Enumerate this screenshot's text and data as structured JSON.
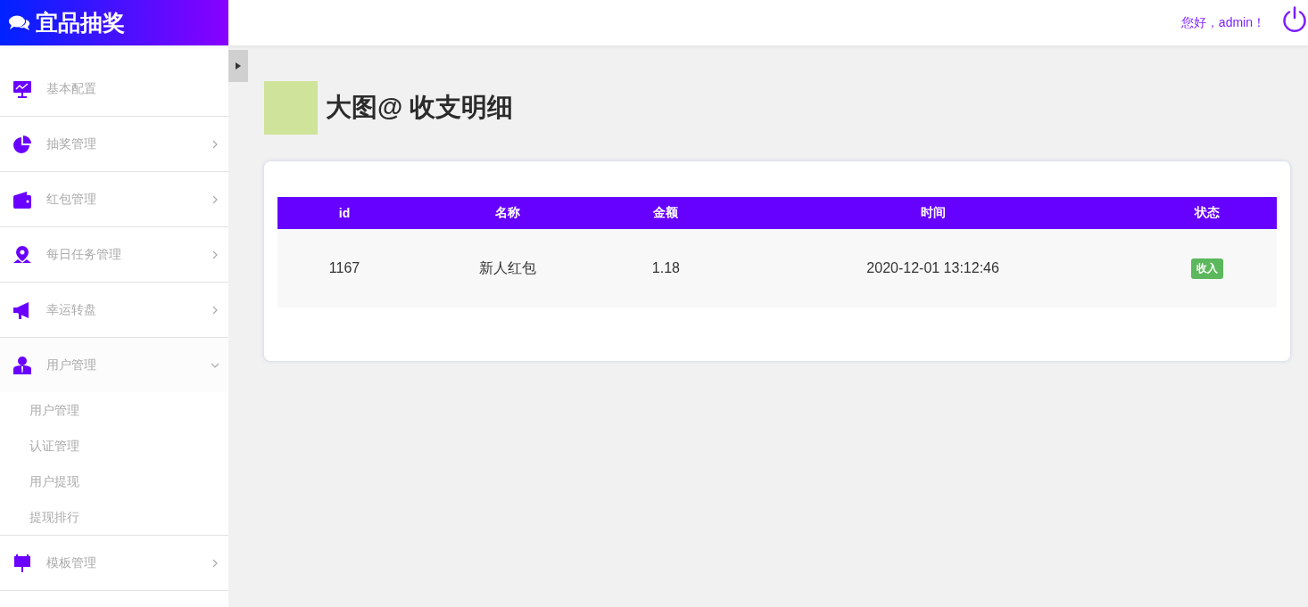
{
  "brand": {
    "title": "宜品抽奖"
  },
  "header": {
    "greeting": "您好，admin！"
  },
  "sidebar": {
    "items": [
      {
        "label": "基本配置"
      },
      {
        "label": "抽奖管理",
        "expanded": false
      },
      {
        "label": "红包管理",
        "expanded": false
      },
      {
        "label": "每日任务管理",
        "expanded": false
      },
      {
        "label": "幸运转盘",
        "expanded": false
      },
      {
        "label": "用户管理",
        "expanded": true,
        "children": [
          {
            "label": "用户管理"
          },
          {
            "label": "认证管理"
          },
          {
            "label": "用户提现"
          },
          {
            "label": "提现排行"
          }
        ]
      },
      {
        "label": "模板管理",
        "expanded": false
      }
    ]
  },
  "page": {
    "title": "大图@ 收支明细"
  },
  "table": {
    "columns": [
      "id",
      "名称",
      "金额",
      "时间",
      "状态"
    ],
    "rows": [
      {
        "cells": [
          "1167",
          "新人红包",
          "1.18",
          "2020-12-01 13:12:46"
        ],
        "status": {
          "text": "收入",
          "kind": "income"
        }
      }
    ]
  }
}
